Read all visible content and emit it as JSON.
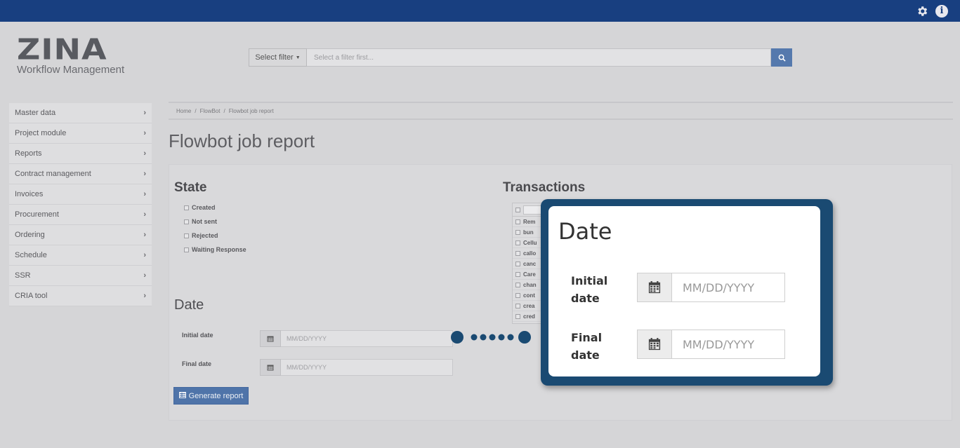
{
  "topbar": {
    "icons": [
      "gear-icon",
      "info-icon"
    ],
    "color": "#183f80"
  },
  "logo": {
    "mark": "ZINA",
    "subtitle": "Workflow Management"
  },
  "filter": {
    "select_label": "Select filter",
    "placeholder": "Select a filter first...",
    "search_icon": "search-icon"
  },
  "sidebar": {
    "items": [
      {
        "label": "Master data"
      },
      {
        "label": "Project module"
      },
      {
        "label": "Reports"
      },
      {
        "label": "Contract management"
      },
      {
        "label": "Invoices"
      },
      {
        "label": "Procurement"
      },
      {
        "label": "Ordering"
      },
      {
        "label": "Schedule"
      },
      {
        "label": "SSR"
      },
      {
        "label": "CRIA tool"
      }
    ]
  },
  "breadcrumb": {
    "items": [
      "Home",
      "FlowBot",
      "Flowbot job report"
    ],
    "separator": "/"
  },
  "page": {
    "title": "Flowbot job report"
  },
  "state": {
    "heading": "State",
    "options": [
      "Created",
      "Not sent",
      "Rejected",
      "Waiting Response"
    ]
  },
  "transactions": {
    "heading": "Transactions",
    "items": [
      "Rem",
      "bun",
      "Cellu",
      "callo",
      "canc",
      "Care",
      "chan",
      "cont",
      "crea",
      "cred"
    ]
  },
  "date": {
    "heading": "Date",
    "initial_label": "Initial date",
    "final_label": "Final date",
    "placeholder": "MM/DD/YYYY"
  },
  "generate_button": {
    "label": "Generate report"
  },
  "callout": {
    "title": "Date",
    "initial_label": "Initial date",
    "final_label": "Final date",
    "placeholder": "MM/DD/YYYY",
    "frame_color": "#1a4a72"
  }
}
